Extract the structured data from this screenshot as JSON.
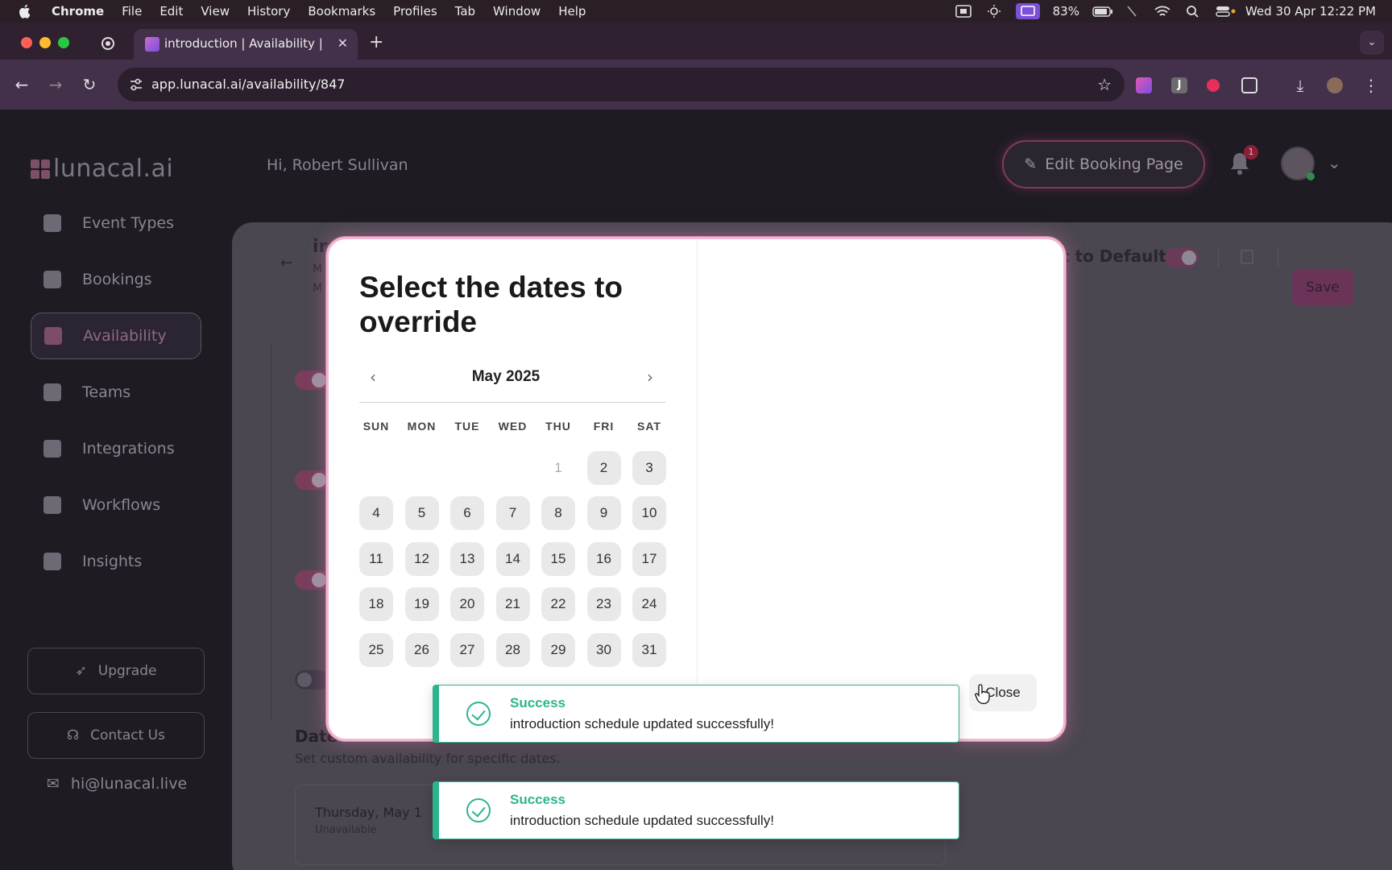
{
  "menubar": {
    "app": "Chrome",
    "menus": [
      "File",
      "Edit",
      "View",
      "History",
      "Bookmarks",
      "Profiles",
      "Tab",
      "Window",
      "Help"
    ],
    "battery": "83%",
    "clock": "Wed 30 Apr  12:22 PM"
  },
  "browser": {
    "tab_title": "introduction | Availability | Lun",
    "url": "app.lunacal.ai/availability/847",
    "new_tab": "+",
    "tab_close": "✕"
  },
  "app": {
    "logo": "lunacal.ai",
    "greeting": "Hi, Robert Sullivan",
    "edit_booking": "Edit Booking Page",
    "notification_count": "1",
    "sidebar": {
      "items": [
        {
          "label": "Event Types",
          "icon": "flag-icon"
        },
        {
          "label": "Bookings",
          "icon": "phone-icon"
        },
        {
          "label": "Availability",
          "icon": "calendar-icon",
          "active": true
        },
        {
          "label": "Teams",
          "icon": "users-icon"
        },
        {
          "label": "Integrations",
          "icon": "grid-icon"
        },
        {
          "label": "Workflows",
          "icon": "workflow-icon"
        },
        {
          "label": "Insights",
          "icon": "bulb-icon"
        }
      ],
      "upgrade": "Upgrade",
      "contact": "Contact Us",
      "email": "hi@lunacal.live"
    },
    "background": {
      "title_fragment": "ir",
      "line1": "M",
      "line2": "M",
      "reset_fragment": "t to Default",
      "save": "Save",
      "date_overrides_fragment": "Date",
      "date_overrides_sub": "Set custom availability for specific dates.",
      "override_date": "Thursday, May 1",
      "override_status": "Unavailable"
    }
  },
  "modal": {
    "title": "Select the dates to override",
    "month": "May 2025",
    "weekdays": [
      "SUN",
      "MON",
      "TUE",
      "WED",
      "THU",
      "FRI",
      "SAT"
    ],
    "weeks": [
      [
        "",
        "",
        "",
        "",
        "1",
        "2",
        "3"
      ],
      [
        "4",
        "5",
        "6",
        "7",
        "8",
        "9",
        "10"
      ],
      [
        "11",
        "12",
        "13",
        "14",
        "15",
        "16",
        "17"
      ],
      [
        "18",
        "19",
        "20",
        "21",
        "22",
        "23",
        "24"
      ],
      [
        "25",
        "26",
        "27",
        "28",
        "29",
        "30",
        "31"
      ]
    ],
    "close": "Close"
  },
  "toasts": [
    {
      "title": "Success",
      "message": "introduction schedule updated successfully!"
    },
    {
      "title": "Success",
      "message": "introduction schedule updated successfully!"
    }
  ],
  "colors": {
    "accent": "#2bb58f",
    "brand": "#c86bd6",
    "modal_border": "#f0b8cf"
  }
}
